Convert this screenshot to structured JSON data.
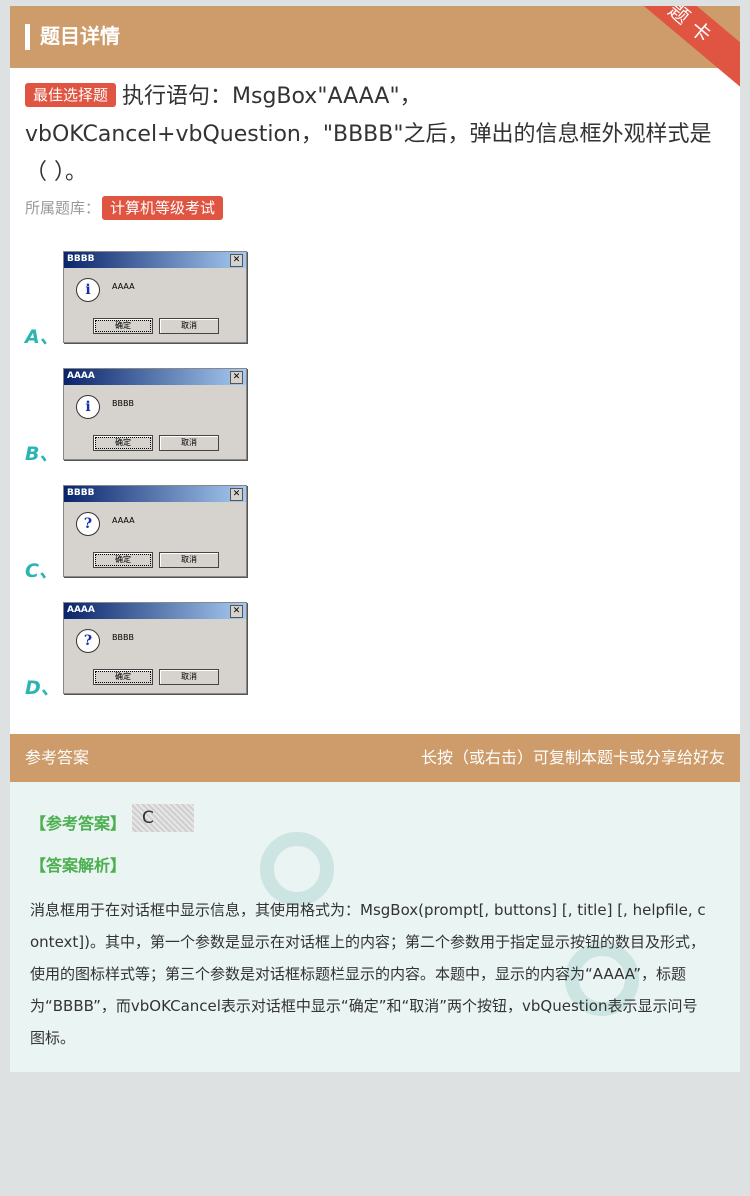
{
  "header": {
    "title": "题目详情",
    "ribbon": "题卡"
  },
  "question": {
    "type_tag": "最佳选择题",
    "text": "执行语句：MsgBox\"AAAA\"，vbOKCancel+vbQuestion，\"BBBB\"之后，弹出的信息框外观样式是（ ）。",
    "source_label": "所属题库：",
    "source_tag": "计算机等级考试"
  },
  "options": [
    {
      "letter": "A、",
      "title": "BBBB",
      "message": "AAAA",
      "icon": "info-icon",
      "glyph": "i",
      "ok": "确定",
      "cancel": "取消"
    },
    {
      "letter": "B、",
      "title": "AAAA",
      "message": "BBBB",
      "icon": "info-icon",
      "glyph": "i",
      "ok": "确定",
      "cancel": "取消"
    },
    {
      "letter": "C、",
      "title": "BBBB",
      "message": "AAAA",
      "icon": "question-icon",
      "glyph": "?",
      "ok": "确定",
      "cancel": "取消"
    },
    {
      "letter": "D、",
      "title": "AAAA",
      "message": "BBBB",
      "icon": "question-icon",
      "glyph": "?",
      "ok": "确定",
      "cancel": "取消"
    }
  ],
  "answer": {
    "bar_left": "参考答案",
    "bar_right": "长按（或右击）可复制本题卡或分享给好友",
    "ref_label": "【参考答案】",
    "ref_value": "C",
    "analysis_label": "【答案解析】",
    "analysis_text": "消息框用于在对话框中显示信息，其使用格式为：MsgBox(prompt[, buttons] [, title] [, helpfile, context])。其中，第一个参数是显示在对话框上的内容；第二个参数用于指定显示按钮的数目及形式，使用的图标样式等；第三个参数是对话框标题栏显示的内容。本题中，显示的内容为“AAAA”，标题为“BBBB”，而vbOKCancel表示对话框中显示“确定”和“取消”两个按钮，vbQuestion表示显示问号图标。"
  },
  "colors": {
    "header": "#cd9c6a",
    "tag": "#e05442",
    "letter": "#2bb5b2",
    "answer_label": "#4caf50"
  }
}
